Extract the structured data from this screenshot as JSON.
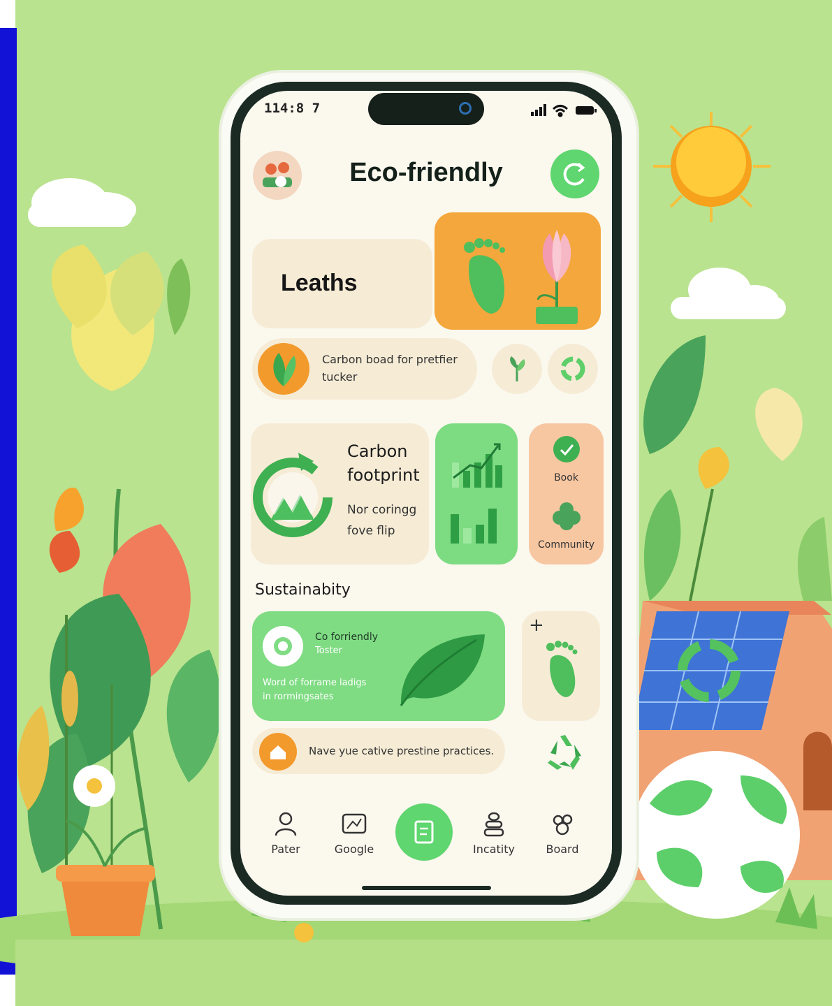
{
  "status_bar": {
    "time": "114:8 7"
  },
  "header": {
    "title": "Eco-friendly"
  },
  "hero": {
    "title": "Leaths"
  },
  "tip_banner": {
    "text_line1": "Carbon boad for pretfier",
    "text_line2": "tucker"
  },
  "carbon_card": {
    "title_line1": "Carbon",
    "title_line2": "footprint",
    "sub_line1": "Nor coringg",
    "sub_line2": "fove flip"
  },
  "side_card": {
    "top_label": "Book",
    "bottom_label": "Community"
  },
  "section": {
    "title": "Sustainabity"
  },
  "tracker_card": {
    "title_line1": "Co forriendly",
    "title_line2": "Toster",
    "desc_line1": "Word of forrame ladigs",
    "desc_line2": "in rormingsates"
  },
  "add_card": {
    "plus": "+"
  },
  "practice_banner": {
    "text": "Nave yue cative prestine practices."
  },
  "bottom_nav": {
    "items": [
      {
        "label": "Pater",
        "icon": "person-icon"
      },
      {
        "label": "Google",
        "icon": "map-icon"
      },
      {
        "label": "",
        "icon": "document-icon"
      },
      {
        "label": "Incatity",
        "icon": "stack-icon"
      },
      {
        "label": "Board",
        "icon": "community-icon"
      }
    ]
  },
  "colors": {
    "background": "#b7e08a",
    "accent_green": "#5ccf6a",
    "orange": "#f4a73c",
    "cream": "#f6ecd6",
    "frame": "#1b2b24"
  }
}
